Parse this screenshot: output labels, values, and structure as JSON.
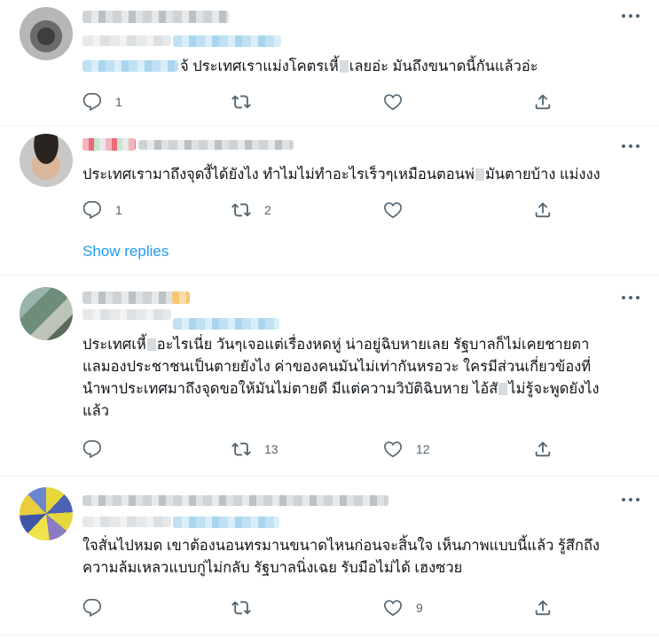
{
  "tweets": [
    {
      "text_parts": [
        "จ้ ประเทศเราแม่งโคตรเหี้",
        "เลยอ่ะ มันถึงขนาดนี้กันแล้วอ่ะ"
      ],
      "actions": {
        "reply": "1",
        "retweet": "",
        "like": "",
        "share": ""
      }
    },
    {
      "text_parts": [
        "ประเทศเรามาถึงจุดงี้ได้ยังไง ทำไมไม่ทำอะไรเร็วๆเหมือนตอนพ่",
        "มันตายบ้าง แม่งงง"
      ],
      "actions": {
        "reply": "1",
        "retweet": "2",
        "like": "",
        "share": ""
      }
    },
    {
      "lines": [
        [
          "ประเทศเหี้",
          "อะไรเนี่ย วันๆเจอแต่เรื่องหดหู่ น่าอยู่ฉิบหายเลย รัฐบาลก็ไม่เคยชายตา"
        ],
        [
          "แลมองประชาชนเป็นตายยังไง ค่าของคนมันไม่เท่ากันหรอวะ ใครมีส่วนเกี่ยวข้องที่"
        ],
        [
          "นำพาประเทศมาถึงจุดขอให้มันไม่ตายดี มีแต่ความวิบัติฉิบหาย ไอ้สั",
          "ไม่รู้จะพูดยังไง"
        ],
        [
          "แล้ว"
        ]
      ],
      "actions": {
        "reply": "",
        "retweet": "13",
        "like": "12",
        "share": ""
      }
    },
    {
      "lines": [
        [
          "ใจสั่นไปหมด เขาต้องนอนทรมานขนาดไหนก่อนจะสิ้นใจ เห็นภาพแบบนี้แล้ว รู้สึกถึง"
        ],
        [
          "ความล้มเหลวแบบกู่ไม่กลับ รัฐบาลนิ่งเฉย รับมือไม่ได้ เฮงซวย"
        ]
      ],
      "actions": {
        "reply": "",
        "retweet": "",
        "like": "9",
        "share": ""
      }
    }
  ],
  "show_replies": "Show replies",
  "icons": {
    "reply": "reply-icon",
    "retweet": "retweet-icon",
    "like": "like-icon",
    "share": "share-icon",
    "more": "more-icon"
  },
  "colors": {
    "accent": "#1d9bf0",
    "icon": "#536471",
    "text": "#0f1419",
    "divider": "#eff3f4"
  }
}
